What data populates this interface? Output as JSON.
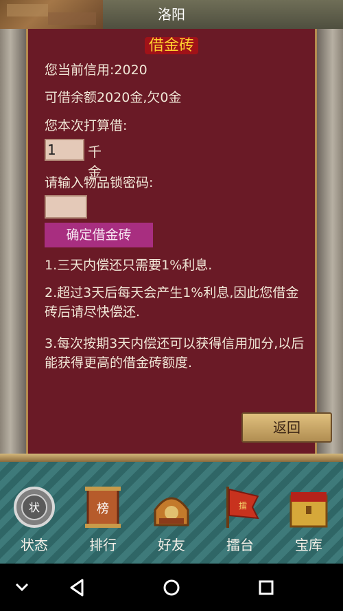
{
  "header": {
    "title": "洛阳"
  },
  "panel": {
    "title": "借金砖",
    "credit_text": "您当前信用:2020",
    "balance_text": "可借余额2020金,欠0金",
    "borrow_prompt": "您本次打算借:",
    "amount_value": "1",
    "amount_unit": "千金",
    "password_prompt": "请输入物品锁密码:",
    "confirm_label": "确定借金砖",
    "notes": [
      "1.三天内偿还只需要1%利息.",
      "2.超过3天后每天会产生1%利息,因此您借金砖后请尽快偿还.",
      "3.每次按期3天内偿还可以获得信用加分,以后能获得更高的借金砖额度."
    ],
    "back_label": "返回"
  },
  "nav": [
    {
      "label": "状态",
      "icon": "status-seal-icon"
    },
    {
      "label": "排行",
      "icon": "ranking-scroll-icon"
    },
    {
      "label": "好友",
      "icon": "friends-helmet-icon"
    },
    {
      "label": "擂台",
      "icon": "arena-flag-icon"
    },
    {
      "label": "宝库",
      "icon": "treasure-chest-icon"
    }
  ],
  "system": {
    "icons": [
      "chevron-down-icon",
      "back-triangle-icon",
      "home-circle-icon",
      "recent-square-icon"
    ]
  }
}
